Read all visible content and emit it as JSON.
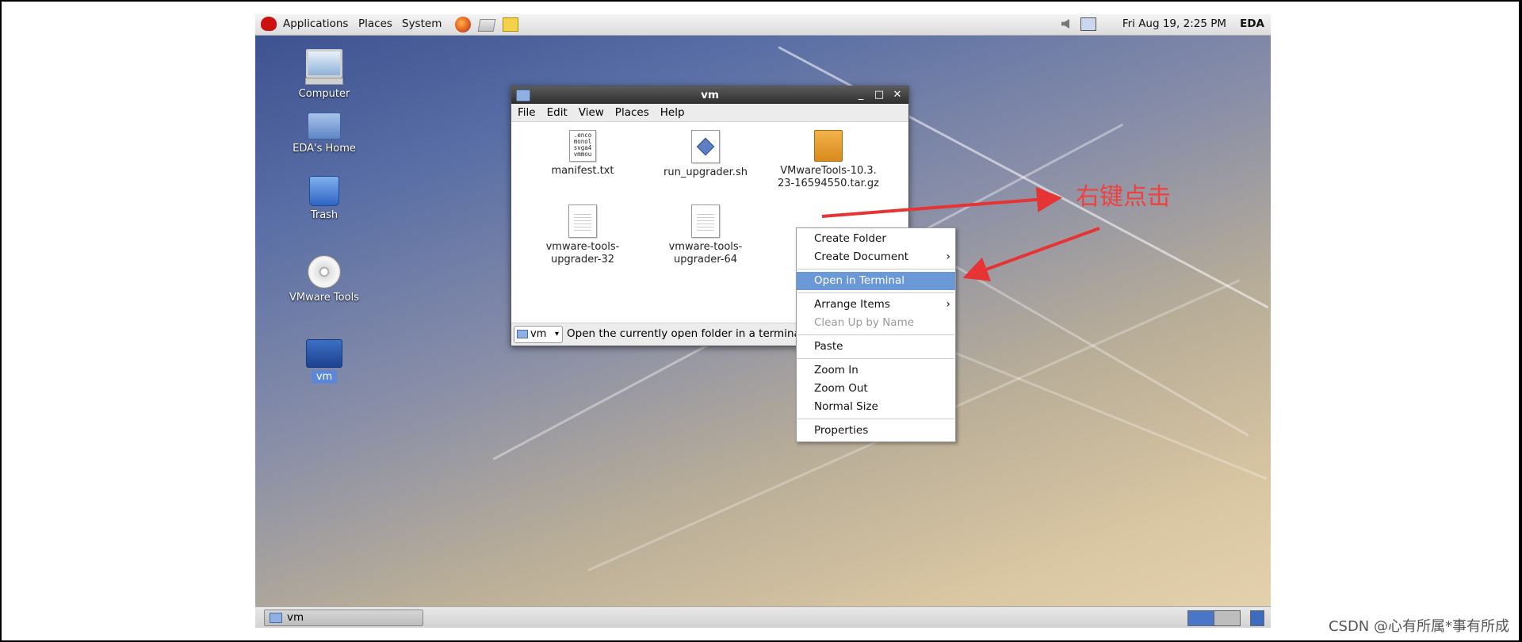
{
  "top_panel": {
    "menus": [
      "Applications",
      "Places",
      "System"
    ],
    "clock": "Fri Aug 19,  2:25 PM",
    "user": "EDA"
  },
  "desktop_icons": [
    {
      "label": "Computer",
      "icon": "computer-icon"
    },
    {
      "label": "EDA's Home",
      "icon": "home-folder-icon"
    },
    {
      "label": "Trash",
      "icon": "trash-icon"
    },
    {
      "label": "VMware Tools",
      "icon": "dvd-icon"
    },
    {
      "label": "vm",
      "icon": "folder-icon"
    }
  ],
  "window": {
    "title": "vm",
    "menu": [
      "File",
      "Edit",
      "View",
      "Places",
      "Help"
    ],
    "files": [
      {
        "name": "manifest.txt",
        "icon": "text-file-icon",
        "preview": [
          ".enco",
          "monol",
          "svga4",
          "vmmou"
        ]
      },
      {
        "name": "run_upgrader.sh",
        "icon": "script-file-icon"
      },
      {
        "name": "VMwareTools-10.3.\n23-16594550.tar.gz",
        "icon": "archive-icon"
      },
      {
        "name": "vmware-tools-\nupgrader-32",
        "icon": "generic-file-icon"
      },
      {
        "name": "vmware-tools-\nupgrader-64",
        "icon": "generic-file-icon"
      }
    ],
    "location": "vm",
    "status": "Open the currently open folder in a terminal"
  },
  "context_menu": {
    "items": [
      {
        "label": "Create Folder"
      },
      {
        "label": "Create Document",
        "submenu": true
      },
      {
        "sep": true
      },
      {
        "label": "Open in Terminal",
        "highlighted": true
      },
      {
        "sep": true
      },
      {
        "label": "Arrange Items",
        "submenu": true
      },
      {
        "label": "Clean Up by Name",
        "disabled": true
      },
      {
        "sep": true
      },
      {
        "label": "Paste"
      },
      {
        "sep": true
      },
      {
        "label": "Zoom In"
      },
      {
        "label": "Zoom Out"
      },
      {
        "label": "Normal Size"
      },
      {
        "sep": true
      },
      {
        "label": "Properties"
      }
    ]
  },
  "taskbar": {
    "task_label": "vm"
  },
  "annotation": {
    "text": "右键点击",
    "color": "#f04040"
  },
  "watermark": "CSDN @心有所属*事有所成"
}
